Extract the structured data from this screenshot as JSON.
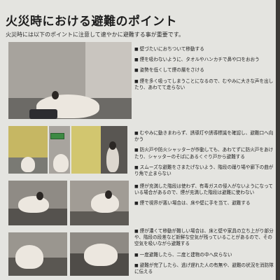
{
  "poster": {
    "title": "火災時における避難のポイント",
    "subtitle": "火災時には以下のポイントに注意して速やかに避難する事が重要です。",
    "section1_points": [
      "壁づたいにおちついて移動する",
      "煙を吸わないように、タオルやハンカチで鼻や口をおおう",
      "姿勢を低くして煙の層をさける",
      "煙を多く吸ってしまうことになるので、むやみに大きな声を出したり、あわてて走らない"
    ],
    "section2_points": [
      "むやみに動きまわらず、誘導灯や誘導標識を確認し、避難口へ向かう",
      "防火戸や防火シャッターが作動しても、あわてずに防火戸をあけたり、シャッターのそばにあるくぐり戸から避難する",
      "スムーズな避難をさまたげないよう、階段の踊り場や廊下の曲がり角で止まらない"
    ],
    "section3_points": [
      "煙が充満した階段は使わず、有毒ガスの侵入がないようになっている場合があるので、煙が充満した階段は避難に使わない",
      "煙で視界が悪い場合は、床や壁に手を当て、避難する"
    ],
    "section4_points": [
      "煙が濃くて移動が難しい場合は、床と壁や家具の立ち上がり部分や、階段の段差など新鮮な空気が残っていることがあるので、その空気を吸いながら避難する",
      "一度避難したら、二度と建物の中へ戻らない",
      "避難が完了したら、逃げ遅れた人の有無や、避難の状況を消防隊に伝える"
    ]
  }
}
